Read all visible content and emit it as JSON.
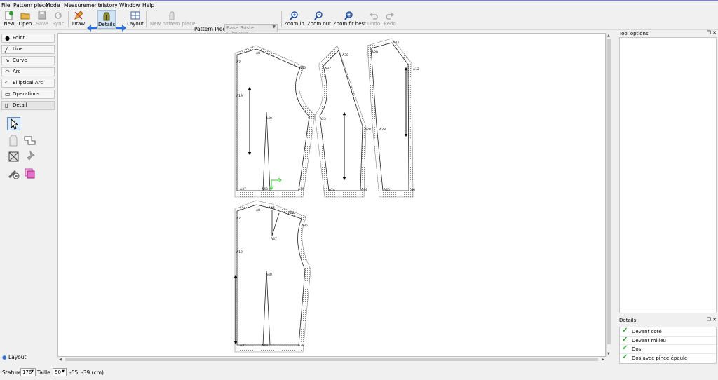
{
  "menu": [
    "File",
    "Pattern piece",
    "Mode",
    "Measurements",
    "History",
    "Window",
    "Help"
  ],
  "toolbar": {
    "new": "New",
    "open": "Open",
    "save": "Save",
    "sync": "Sync",
    "draw": "Draw",
    "details": "Details",
    "layout": "Layout",
    "new_pattern_piece": "New pattern piece",
    "pattern_piece_label": "Pattern Piece:",
    "pattern_piece_value": "Base Buste Gilewska",
    "zoom_in": "Zoom in",
    "zoom_out": "Zoom out",
    "zoom_fit_best": "Zoom fit best",
    "undo": "Undo",
    "redo": "Redo"
  },
  "left_panel": {
    "groups": [
      "Point",
      "Line",
      "Curve",
      "Arc",
      "Elliptical Arc",
      "Operations",
      "Detail"
    ],
    "layout": "Layout"
  },
  "canvas_labels": {
    "p1": [
      "A7",
      "A8",
      "A35",
      "A19",
      "A40",
      "A22",
      "A37",
      "A43",
      "A38"
    ],
    "p2": [
      "A30",
      "A32",
      "A23",
      "A28",
      "A24",
      "A44"
    ],
    "p3": [
      "A29",
      "A33",
      "A12",
      "A28",
      "A45",
      "A6"
    ],
    "p4": [
      "A7",
      "A8",
      "A46",
      "A48",
      "A35",
      "A47",
      "A19",
      "A40",
      "A37",
      "A43",
      "A38"
    ]
  },
  "tool_options": {
    "title": "Tool options"
  },
  "details": {
    "title": "Details",
    "items": [
      "Devant coté",
      "Devant milieu",
      "Dos",
      "Dos avec pince épaule"
    ]
  },
  "status": {
    "stature_label": "Stature:",
    "stature_value": "176",
    "size_label": "Taille :",
    "size_value": "50",
    "coords": "-55, -39 (cm)"
  },
  "colors": {
    "accent": "#1f6fd0",
    "check": "#3aa63a",
    "outline": "#2a2a2a",
    "seam": "#9a9a9a"
  }
}
